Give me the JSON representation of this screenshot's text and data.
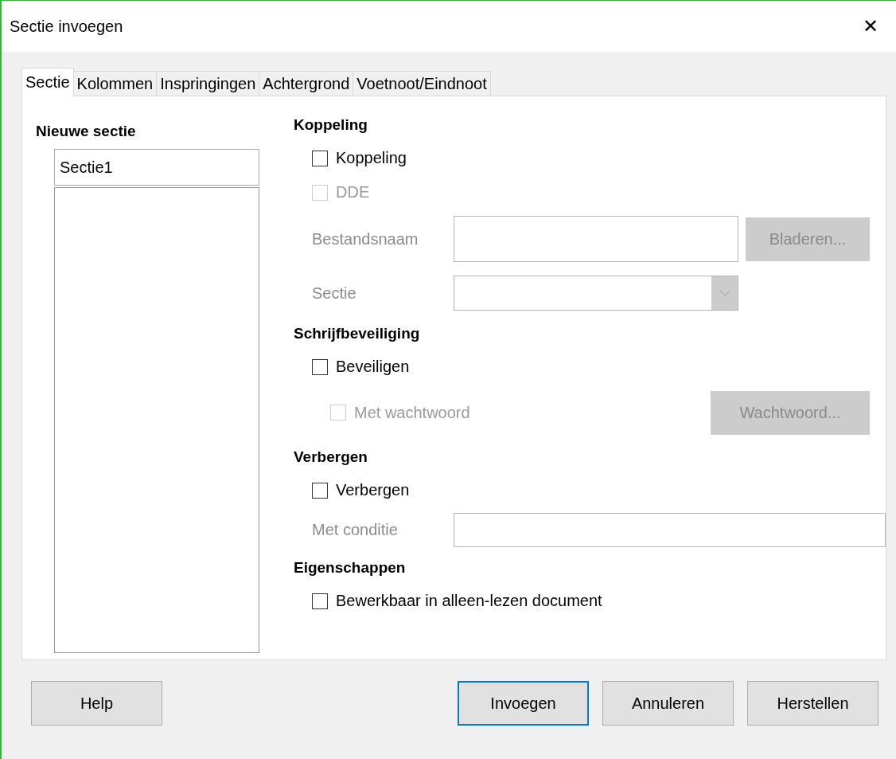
{
  "window": {
    "title": "Sectie invoegen",
    "close": "✕"
  },
  "tabs": [
    {
      "label": "Sectie",
      "selected": true
    },
    {
      "label": "Kolommen",
      "selected": false
    },
    {
      "label": "Inspringingen",
      "selected": false
    },
    {
      "label": "Achtergrond",
      "selected": false
    },
    {
      "label": "Voetnoot/Eindnoot",
      "selected": false
    }
  ],
  "new_section": {
    "heading": "Nieuwe sectie",
    "name_value": "Sectie1"
  },
  "sections": [
    {
      "heading": "Koppeling",
      "rows": [
        {
          "kind": "checkbox",
          "label": "Koppeling",
          "checked": false,
          "disabled": false
        },
        {
          "kind": "checkbox",
          "label": "DDE",
          "checked": false,
          "disabled": true
        },
        {
          "kind": "text-field",
          "label": "Bestandsnaam",
          "disabled": true,
          "button": {
            "label": "Bladeren...",
            "disabled": true
          }
        },
        {
          "kind": "combobox",
          "label": "Sectie",
          "disabled": true
        }
      ]
    },
    {
      "heading": "Schrijfbeveiliging",
      "rows": [
        {
          "kind": "checkbox",
          "label": "Beveiligen",
          "checked": false,
          "disabled": false
        },
        {
          "kind": "sub-checkbox",
          "label": "Met wachtwoord",
          "checked": false,
          "disabled": true,
          "button": {
            "label": "Wachtwoord...",
            "disabled": true
          }
        }
      ]
    },
    {
      "heading": "Verbergen",
      "rows": [
        {
          "kind": "checkbox",
          "label": "Verbergen",
          "checked": false,
          "disabled": false
        },
        {
          "kind": "line-field",
          "label": "Met conditie",
          "disabled": true
        }
      ]
    },
    {
      "heading": "Eigenschappen",
      "rows": [
        {
          "kind": "checkbox",
          "label": "Bewerkbaar in alleen-lezen document",
          "checked": false,
          "disabled": false
        }
      ]
    }
  ],
  "footer_left": [
    {
      "label": "Help",
      "default": false
    }
  ],
  "footer_right": [
    {
      "label": "Invoegen",
      "default": true
    },
    {
      "label": "Annuleren",
      "default": false
    },
    {
      "label": "Herstellen",
      "default": false
    }
  ]
}
